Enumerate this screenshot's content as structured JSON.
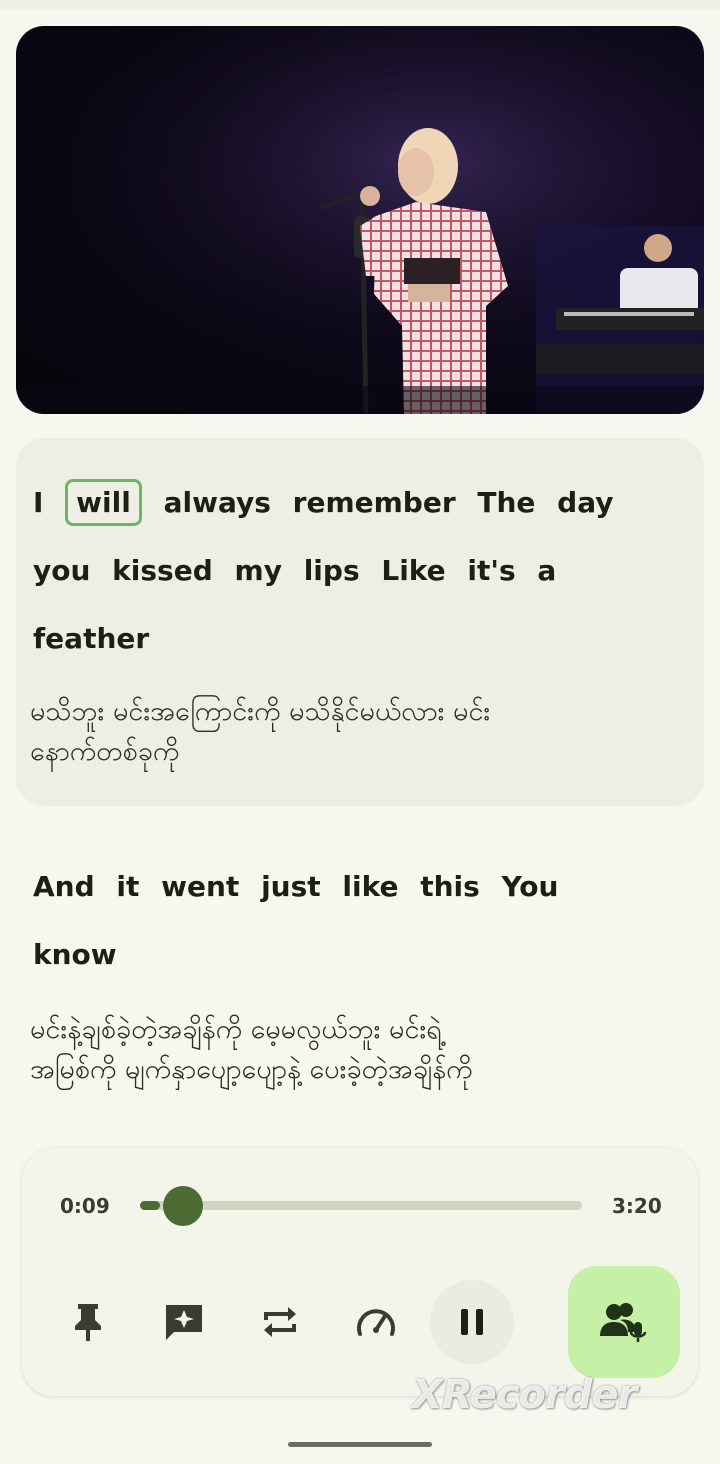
{
  "colors": {
    "background": "#f6f7ee",
    "active_card": "#eeefe4",
    "highlight_border": "#6fb36b",
    "progress": "#4b6b33",
    "karaoke_button": "#c6f0a6"
  },
  "video": {
    "content": "live-performance-video"
  },
  "lyrics": [
    {
      "active": true,
      "english_lines": [
        [
          "I",
          "will",
          "always",
          "remember",
          "The",
          "day"
        ],
        [
          "you",
          "kissed",
          "my",
          "lips",
          "Like",
          "it's",
          "a"
        ],
        [
          "feather"
        ]
      ],
      "highlighted_word": "will",
      "translation_lines": [
        "မသိဘူး မင်းအကြောင်းကို မသိနိုင်မယ်လား မင်း",
        "နောက်တစ်ခုကို"
      ]
    },
    {
      "active": false,
      "english_lines": [
        [
          "And",
          "it",
          "went",
          "just",
          "like",
          "this",
          "You"
        ],
        [
          "know"
        ]
      ],
      "translation_lines": [
        "မင်းနဲ့ချစ်ခဲ့တဲ့အချိန်ကို မေ့မလွယ်ဘူး မင်းရဲ့",
        "အမြစ်ကို မျက်နှာပျော့ပျော့နဲ့ ပေးခဲ့တဲ့အချိန်ကို"
      ]
    }
  ],
  "player": {
    "current_time": "0:09",
    "total_time": "3:20",
    "progress": 0.045,
    "controls": [
      {
        "name": "pin-icon"
      },
      {
        "name": "sparkle-comment-icon"
      },
      {
        "name": "repeat-icon"
      },
      {
        "name": "speed-gauge-icon"
      },
      {
        "name": "pause-icon"
      },
      {
        "name": "karaoke-singer-icon"
      }
    ]
  },
  "watermark": "XRecorder"
}
